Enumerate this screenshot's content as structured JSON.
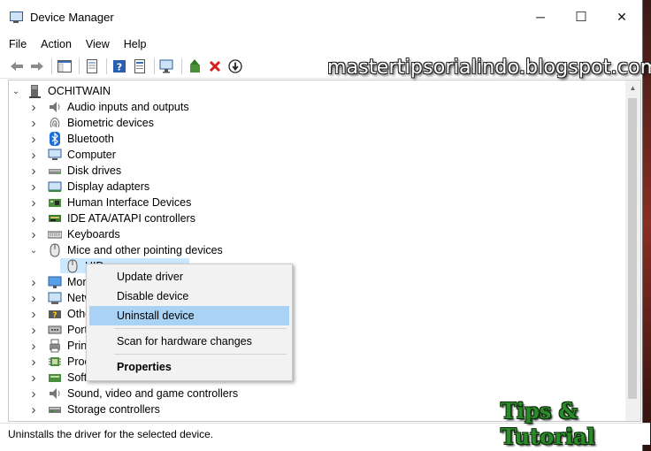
{
  "window": {
    "title": "Device Manager",
    "controls": {
      "minimize": "─",
      "maximize": "☐",
      "close": "✕"
    }
  },
  "menu": [
    "File",
    "Action",
    "View",
    "Help"
  ],
  "toolbar": [
    "back-icon",
    "forward-icon",
    "show-hide-console-tree-icon",
    "properties-sheet-icon",
    "help-icon",
    "device-monitor-icon",
    "update-driver-icon",
    "uninstall-icon",
    "disable-device-icon"
  ],
  "tree": {
    "root": "OCHITWAIN",
    "categories": [
      {
        "label": "Audio inputs and outputs",
        "icon": "speaker-icon"
      },
      {
        "label": "Biometric devices",
        "icon": "fingerprint-icon"
      },
      {
        "label": "Bluetooth",
        "icon": "bluetooth-icon"
      },
      {
        "label": "Computer",
        "icon": "computer-icon"
      },
      {
        "label": "Disk drives",
        "icon": "disk-drive-icon"
      },
      {
        "label": "Display adapters",
        "icon": "display-adapter-icon"
      },
      {
        "label": "Human Interface Devices",
        "icon": "hid-icon"
      },
      {
        "label": "IDE ATA/ATAPI controllers",
        "icon": "ide-controller-icon"
      },
      {
        "label": "Keyboards",
        "icon": "keyboard-icon"
      },
      {
        "label": "Mice and other pointing devices",
        "icon": "mouse-icon"
      },
      {
        "label": "Mon",
        "icon": "monitor-icon"
      },
      {
        "label": "Netw",
        "icon": "network-adapter-icon"
      },
      {
        "label": "Othe",
        "icon": "other-devices-icon"
      },
      {
        "label": "Ports",
        "icon": "port-icon"
      },
      {
        "label": "Print",
        "icon": "print-queue-icon"
      },
      {
        "label": "Proc",
        "icon": "processor-icon"
      },
      {
        "label": "Software devices",
        "icon": "software-device-icon"
      },
      {
        "label": "Sound, video and game controllers",
        "icon": "sound-controller-icon"
      },
      {
        "label": "Storage controllers",
        "icon": "storage-controller-icon"
      }
    ],
    "expanded_child": {
      "label": "HID-compliant mouse",
      "visible_label": "HID",
      "icon": "mouse-icon"
    }
  },
  "context_menu": {
    "items": [
      "Update driver",
      "Disable device",
      "Uninstall device",
      "Scan for hardware changes",
      "Properties"
    ],
    "highlighted": "Uninstall device",
    "bold": "Properties"
  },
  "status": "Uninstalls the driver for the selected device.",
  "watermarks": {
    "top": "mastertipsorialindo.blogspot.com",
    "bottom": "Tips & Tutorial"
  },
  "colors": {
    "highlight": "#a9d2f4",
    "selection": "#cce8ff"
  }
}
